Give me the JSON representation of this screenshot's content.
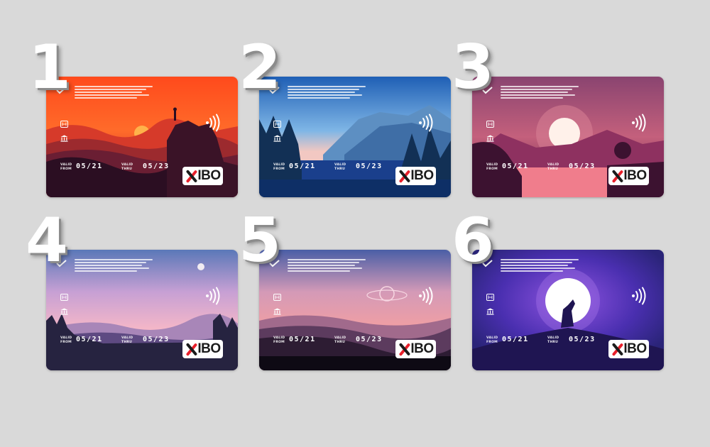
{
  "cards": [
    {
      "number": "1",
      "valid_from": "05/21",
      "valid_thru": "05/23",
      "valid_label_1": "VALID",
      "valid_label_2": "FROM",
      "thru_label_1": "VALID",
      "thru_label_2": "THRU",
      "logo": "XIBO",
      "scene": "red-sunset-hiker"
    },
    {
      "number": "2",
      "valid_from": "05/21",
      "valid_thru": "05/23",
      "valid_label_1": "VALID",
      "valid_label_2": "FROM",
      "thru_label_1": "VALID",
      "thru_label_2": "THRU",
      "logo": "XIBO",
      "scene": "blue-forest-mountains"
    },
    {
      "number": "3",
      "valid_from": "05/21",
      "valid_thru": "05/23",
      "valid_label_1": "VALID",
      "valid_label_2": "FROM",
      "thru_label_1": "VALID",
      "thru_label_2": "THRU",
      "logo": "XIBO",
      "scene": "magenta-sun-lake"
    },
    {
      "number": "4",
      "valid_from": "05/21",
      "valid_thru": "05/23",
      "valid_label_1": "VALID",
      "valid_label_2": "FROM",
      "thru_label_1": "VALID",
      "thru_label_2": "THRU",
      "logo": "XIBO",
      "scene": "pink-dusk-moon"
    },
    {
      "number": "5",
      "valid_from": "05/21",
      "valid_thru": "05/23",
      "valid_label_1": "VALID",
      "valid_label_2": "FROM",
      "thru_label_1": "VALID",
      "thru_label_2": "THRU",
      "logo": "XIBO",
      "scene": "pink-planet-hills"
    },
    {
      "number": "6",
      "valid_from": "05/21",
      "valid_thru": "05/23",
      "valid_label_1": "VALID",
      "valid_label_2": "FROM",
      "thru_label_1": "VALID",
      "thru_label_2": "THRU",
      "logo": "XIBO",
      "scene": "purple-wolf-moon"
    }
  ],
  "colors": {
    "background": "#d9d9d9",
    "logo_accent": "#e8202b",
    "logo_text": "#1b1b1b"
  },
  "icons": [
    "contactless-icon",
    "chip-icon",
    "bank-icon",
    "checkmark-icon"
  ]
}
